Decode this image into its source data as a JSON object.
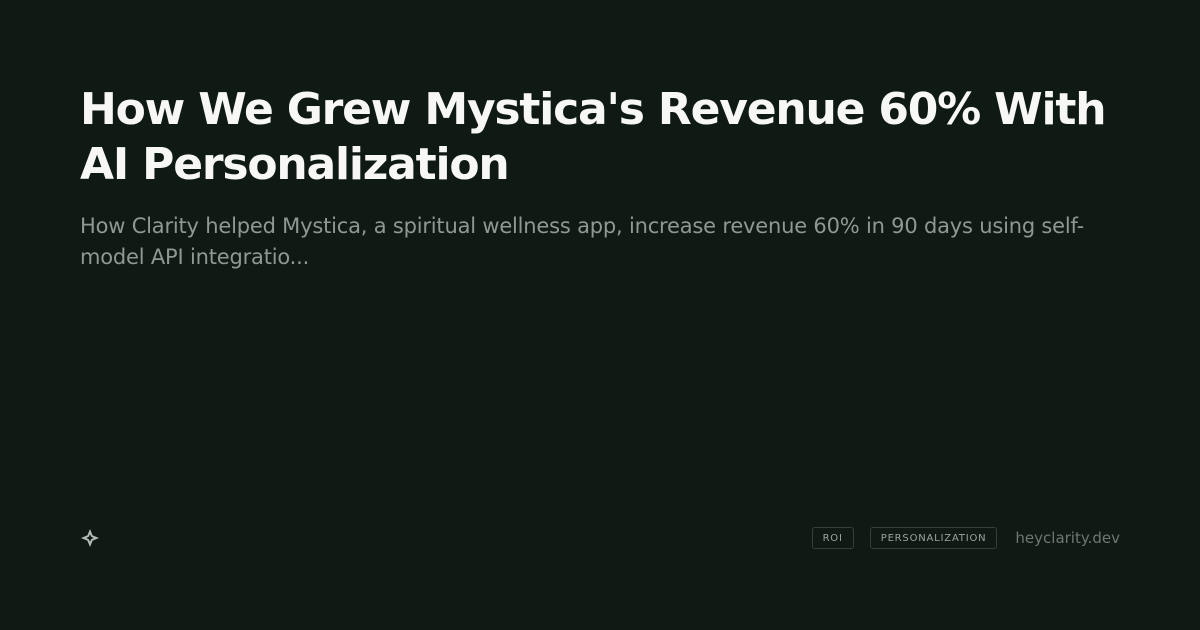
{
  "card": {
    "title": "How We Grew Mystica's Revenue 60% With AI Personalization",
    "subtitle": "How Clarity helped Mystica, a spiritual wellness app, increase revenue 60% in 90 days using self-model API integratio...",
    "logo_icon": "sparkle-star-icon",
    "tags": [
      {
        "label": "ROI"
      },
      {
        "label": "PERSONALIZATION"
      }
    ],
    "domain": "heyclarity.dev"
  },
  "colors": {
    "background": "#101a15",
    "title": "#f7f7f6",
    "subtitle": "#8f9893",
    "tag_border": "#36403a",
    "tag_text": "#9aa39e",
    "domain": "#6e7772",
    "logo": "#b7beb9"
  }
}
